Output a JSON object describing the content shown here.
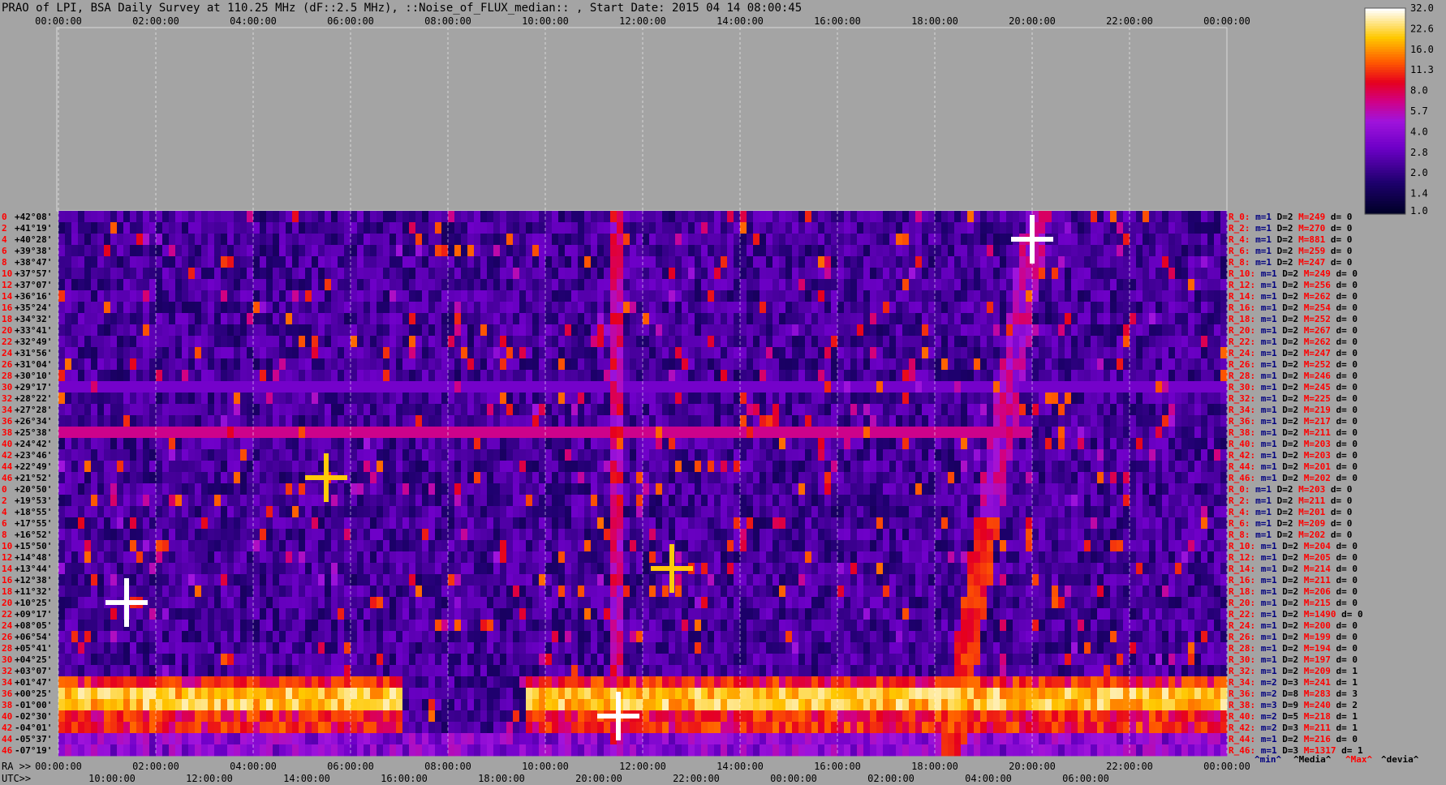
{
  "title": "PRAO of LPI, BSA Daily Survey at 110.25 MHz (dF::2.5 MHz), ::Noise_of_FLUX_median:: , Start Date: 2015 04 14 08:00:45",
  "chart_data": {
    "type": "heatmap",
    "title": "PRAO of LPI, BSA Daily Survey at 110.25 MHz (dF::2.5 MHz), ::Noise_of_FLUX_median:: , Start Date: 2015 04 14 08:00:45",
    "x_top_ticks": [
      "00:00:00",
      "02:00:00",
      "04:00:00",
      "06:00:00",
      "08:00:00",
      "10:00:00",
      "12:00:00",
      "14:00:00",
      "16:00:00",
      "18:00:00",
      "20:00:00",
      "22:00:00",
      "00:00:00"
    ],
    "x_bottom_label_ra": "RA >>",
    "x_bottom_label_utc": "UTC>>",
    "x_ra_ticks": [
      "00:00:00",
      "02:00:00",
      "04:00:00",
      "06:00:00",
      "08:00:00",
      "10:00:00",
      "12:00:00",
      "14:00:00",
      "16:00:00",
      "18:00:00",
      "20:00:00",
      "22:00:00",
      "00:00:00"
    ],
    "x_utc_ticks": [
      "10:00:00",
      "12:00:00",
      "14:00:00",
      "16:00:00",
      "18:00:00",
      "20:00:00",
      "22:00:00",
      "00:00:00",
      "02:00:00",
      "04:00:00",
      "06:00:00"
    ],
    "row_index": [
      "0",
      "2",
      "4",
      "6",
      "8",
      "10",
      "12",
      "14",
      "16",
      "18",
      "20",
      "22",
      "24",
      "26",
      "28",
      "30",
      "32",
      "34",
      "36",
      "38",
      "40",
      "42",
      "44",
      "46",
      "0",
      "2",
      "4",
      "6",
      "8",
      "10",
      "12",
      "14",
      "16",
      "18",
      "20",
      "22",
      "24",
      "26",
      "28",
      "30",
      "32",
      "34",
      "36",
      "38",
      "40",
      "42",
      "44",
      "46"
    ],
    "declinations": [
      "+42°08'",
      "+41°19'",
      "+40°28'",
      "+39°38'",
      "+38°47'",
      "+37°57'",
      "+37°07'",
      "+36°16'",
      "+35°24'",
      "+34°32'",
      "+33°41'",
      "+32°49'",
      "+31°56'",
      "+31°04'",
      "+30°10'",
      "+29°17'",
      "+28°22'",
      "+27°28'",
      "+26°34'",
      "+25°38'",
      "+24°42'",
      "+23°46'",
      "+22°49'",
      "+21°52'",
      "+20°50'",
      "+19°53'",
      "+18°55'",
      "+17°55'",
      "+16°52'",
      "+15°50'",
      "+14°48'",
      "+13°44'",
      "+12°38'",
      "+11°32'",
      "+10°25'",
      "+09°17'",
      "+08°05'",
      "+06°54'",
      "+05°41'",
      "+04°25'",
      "+03°07'",
      "+01°47'",
      "+00°25'",
      "-01°00'",
      "-02°30'",
      "-04°01'",
      "-05°37'",
      "-07°19'"
    ],
    "row_stats": [
      "R_0: m=1 D=2 M=249 d= 0",
      "R_2: m=1 D=2 M=270 d= 0",
      "R_4: m=1 D=2 M=881 d= 0",
      "R_6: m=1 D=2 M=259 d= 0",
      "R_8: m=1 D=2 M=247 d= 0",
      "R_10: m=1 D=2 M=249 d= 0",
      "R_12: m=1 D=2 M=256 d= 0",
      "R_14: m=1 D=2 M=262 d= 0",
      "R_16: m=1 D=2 M=254 d= 0",
      "R_18: m=1 D=2 M=252 d= 0",
      "R_20: m=1 D=2 M=267 d= 0",
      "R_22: m=1 D=2 M=262 d= 0",
      "R_24: m=1 D=2 M=247 d= 0",
      "R_26: m=1 D=2 M=252 d= 0",
      "R_28: m=1 D=2 M=246 d= 0",
      "R_30: m=1 D=2 M=245 d= 0",
      "R_32: m=1 D=2 M=225 d= 0",
      "R_34: m=1 D=2 M=219 d= 0",
      "R_36: m=1 D=2 M=217 d= 0",
      "R_38: m=1 D=2 M=211 d= 0",
      "R_40: m=1 D=2 M=203 d= 0",
      "R_42: m=1 D=2 M=203 d= 0",
      "R_44: m=1 D=2 M=201 d= 0",
      "R_46: m=1 D=2 M=202 d= 0",
      "R_0: m=1 D=2 M=203 d= 0",
      "R_2: m=1 D=2 M=211 d= 0",
      "R_4: m=1 D=2 M=201 d= 0",
      "R_6: m=1 D=2 M=209 d= 0",
      "R_8: m=1 D=2 M=202 d= 0",
      "R_10: m=1 D=2 M=204 d= 0",
      "R_12: m=1 D=2 M=205 d= 0",
      "R_14: m=1 D=2 M=214 d= 0",
      "R_16: m=1 D=2 M=211 d= 0",
      "R_18: m=1 D=2 M=206 d= 0",
      "R_20: m=1 D=2 M=215 d= 0",
      "R_22: m=1 D=2 M=1490 d= 0",
      "R_24: m=1 D=2 M=200 d= 0",
      "R_26: m=1 D=2 M=199 d= 0",
      "R_28: m=1 D=2 M=194 d= 0",
      "R_30: m=1 D=2 M=197 d= 0",
      "R_32: m=1 D=2 M=209 d= 1",
      "R_34: m=2 D=3 M=241 d= 1",
      "R_36: m=2 D=8 M=283 d= 3",
      "R_38: m=3 D=9 M=240 d= 2",
      "R_40: m=2 D=5 M=218 d= 1",
      "R_42: m=2 D=3 M=211 d= 1",
      "R_44: m=1 D=2 M=216 d= 0",
      "R_46: m=1 D=3 M=1317 d= 1"
    ],
    "stat_legend": [
      "^min^",
      "^Media^",
      "^Max^",
      "^devia^"
    ],
    "stat_legend_colors": [
      "#000080",
      "#000000",
      "#ff0000",
      "#000000"
    ],
    "colorbar_ticks": [
      "32.0",
      "22.6",
      "16.0",
      "11.3",
      "8.0",
      "5.7",
      "4.0",
      "2.8",
      "2.0",
      "1.4",
      "1.0"
    ],
    "colorscale": "log",
    "value_range": [
      1.0,
      32.0
    ],
    "hot_band_rows_ra_hours": [
      [
        0,
        7
      ],
      [
        9.6,
        24
      ]
    ],
    "point_sources": [
      {
        "ra_h": 20.0,
        "row": 2,
        "v": 32
      },
      {
        "ra_h": 1.4,
        "row": 34,
        "v": 32
      },
      {
        "ra_h": 5.5,
        "row": 23,
        "v": 20
      },
      {
        "ra_h": 12.6,
        "row": 31,
        "v": 20
      },
      {
        "ra_h": 11.5,
        "row": 44,
        "v": 32
      }
    ]
  },
  "colors": {
    "background": "#a4a4a4",
    "row_index_color": "#ff0000",
    "stat_label_color": "#ff0000",
    "stat_min_color": "#000080",
    "stat_max_color": "#ff0000"
  }
}
